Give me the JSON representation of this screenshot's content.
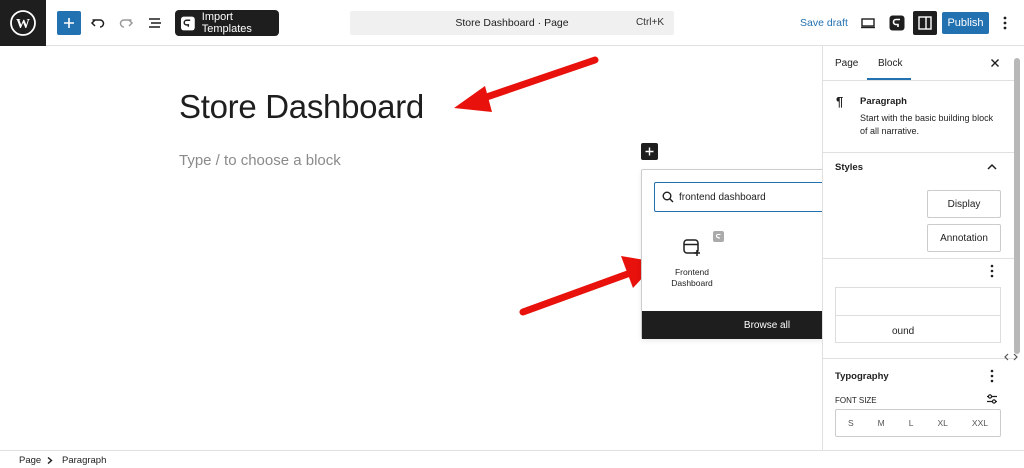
{
  "toolbar": {
    "import_label": "Import Templates",
    "doc_title": "Store Dashboard · Page",
    "shortcut": "Ctrl+K",
    "save_draft": "Save draft",
    "publish": "Publish",
    "accent": "#2271b1"
  },
  "canvas": {
    "title": "Store Dashboard",
    "placeholder": "Type / to choose a block"
  },
  "inserter": {
    "search_value": "frontend dashboard",
    "result": {
      "label_line1": "Frontend",
      "label_line2": "Dashboard",
      "icon": "frontend-dashboard-icon"
    },
    "browse_all": "Browse all"
  },
  "sidebar": {
    "tabs": [
      "Page",
      "Block"
    ],
    "active_tab": "Block",
    "block_name": "Paragraph",
    "block_desc_line1": "Start with the basic building block",
    "block_desc_line2": "of all narrative.",
    "styles_heading": "Styles",
    "style_display": "Display",
    "style_annotation": "Annotation",
    "color_partial": "ound",
    "typography_heading": "Typography",
    "font_size_label": "FONT SIZE",
    "font_sizes": [
      "S",
      "M",
      "L",
      "XL",
      "XXL"
    ]
  },
  "breadcrumb": [
    "Page",
    "Paragraph"
  ]
}
